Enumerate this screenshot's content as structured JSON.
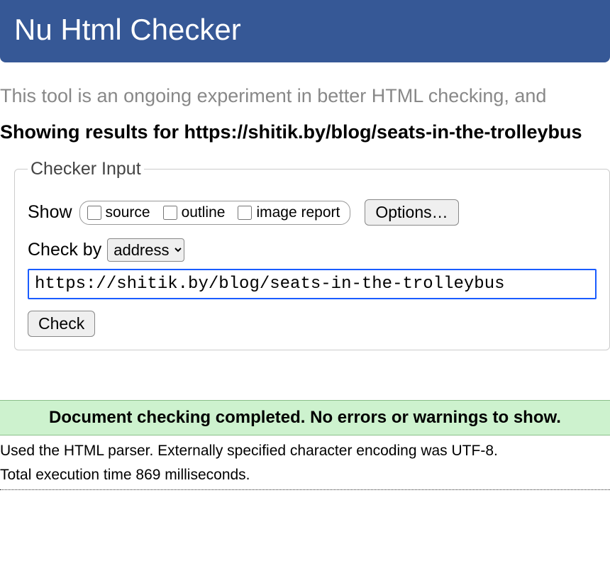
{
  "header": {
    "title": "Nu Html Checker"
  },
  "intro": "This tool is an ongoing experiment in better HTML checking, and",
  "results_heading": "Showing results for https://shitik.by/blog/seats-in-the-trolleybus",
  "fieldset": {
    "legend": "Checker Input",
    "show_label": "Show",
    "checkboxes": {
      "source": "source",
      "outline": "outline",
      "image_report": "image report"
    },
    "options_button": "Options…",
    "checkby_label": "Check by",
    "checkby_selected": "address",
    "url_value": "https://shitik.by/blog/seats-in-the-trolleybus",
    "check_button": "Check"
  },
  "success": "Document checking completed. No errors or warnings to show.",
  "parser_line": "Used the HTML parser. Externally specified character encoding was UTF-8.",
  "timing_line": "Total execution time 869 milliseconds."
}
